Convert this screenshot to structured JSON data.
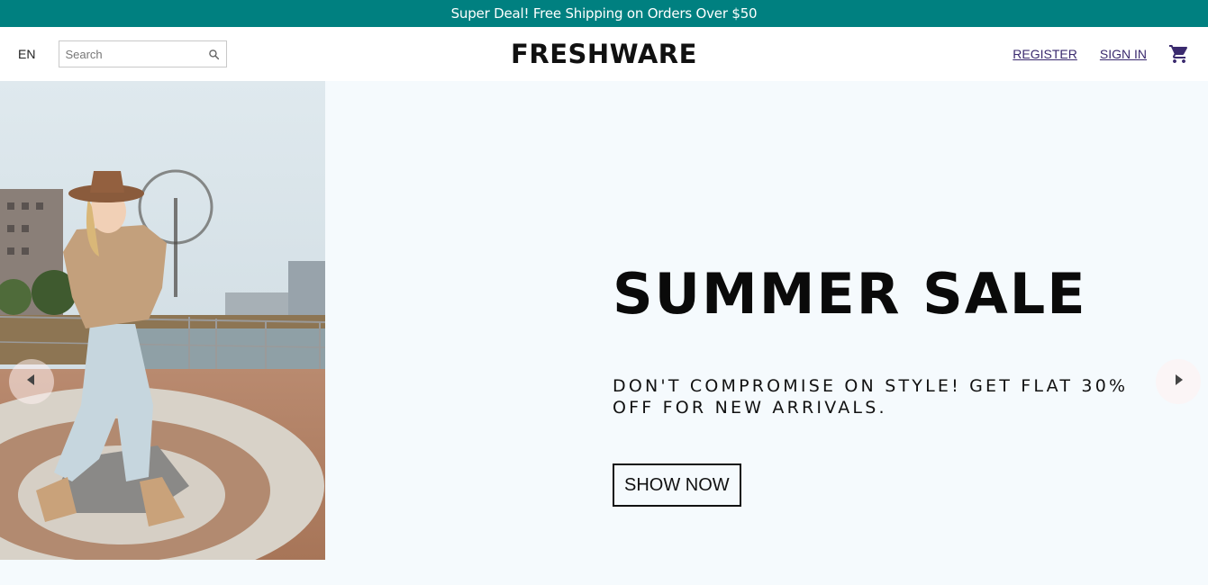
{
  "announcement": {
    "text": "Super Deal! Free Shipping on Orders Over $50"
  },
  "header": {
    "language": "EN",
    "search": {
      "placeholder": "Search",
      "value": ""
    },
    "logo": "FRESHWARE",
    "links": {
      "register": "REGISTER",
      "sign_in": "SIGN IN"
    },
    "icons": {
      "search": "search-icon",
      "cart": "shopping-cart-icon"
    }
  },
  "slider": {
    "title": "SUMMER SALE",
    "description": "DON'T COMPROMISE ON STYLE! GET FLAT 30% OFF FOR NEW ARRIVALS.",
    "button": "SHOW NOW",
    "icons": {
      "prev": "arrow-left-icon",
      "next": "arrow-right-icon"
    }
  },
  "colors": {
    "announcement_bg": "#008080",
    "slide_bg": "#f5fafd",
    "link": "#3a2a6e"
  }
}
